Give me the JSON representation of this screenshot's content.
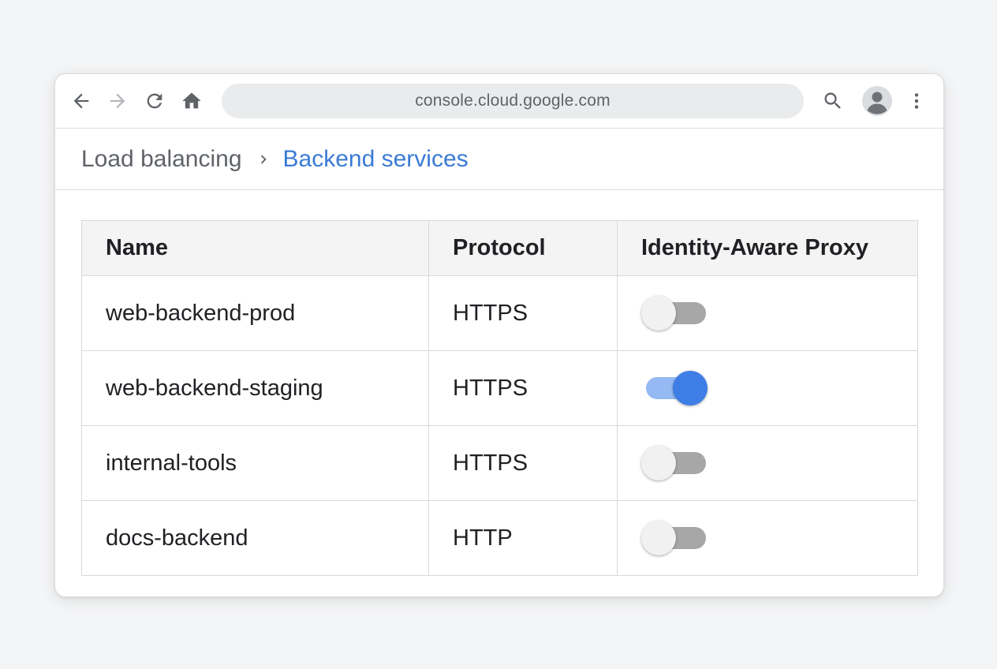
{
  "browser": {
    "url": "console.cloud.google.com",
    "icons": {
      "back": "arrow-left-icon",
      "forward": "arrow-right-icon",
      "reload": "reload-icon",
      "home": "home-icon",
      "search": "search-icon",
      "account": "account-avatar-icon",
      "menu": "more-vert-icon"
    }
  },
  "breadcrumb": {
    "root": "Load balancing",
    "separator_icon": "chevron-right-icon",
    "current": "Backend services"
  },
  "table": {
    "columns": [
      "Name",
      "Protocol",
      "Identity-Aware Proxy"
    ],
    "rows": [
      {
        "name": "web-backend-prod",
        "protocol": "HTTPS",
        "iap_enabled": false
      },
      {
        "name": "web-backend-staging",
        "protocol": "HTTPS",
        "iap_enabled": true
      },
      {
        "name": "internal-tools",
        "protocol": "HTTPS",
        "iap_enabled": false
      },
      {
        "name": "docs-backend",
        "protocol": "HTTP",
        "iap_enabled": false
      }
    ]
  },
  "colors": {
    "accent": "#3a7bd5",
    "toggle_on": "#3f7ee6",
    "toggle_on_track": "#94b9f3",
    "toggle_off_track": "#a7a7a7"
  }
}
